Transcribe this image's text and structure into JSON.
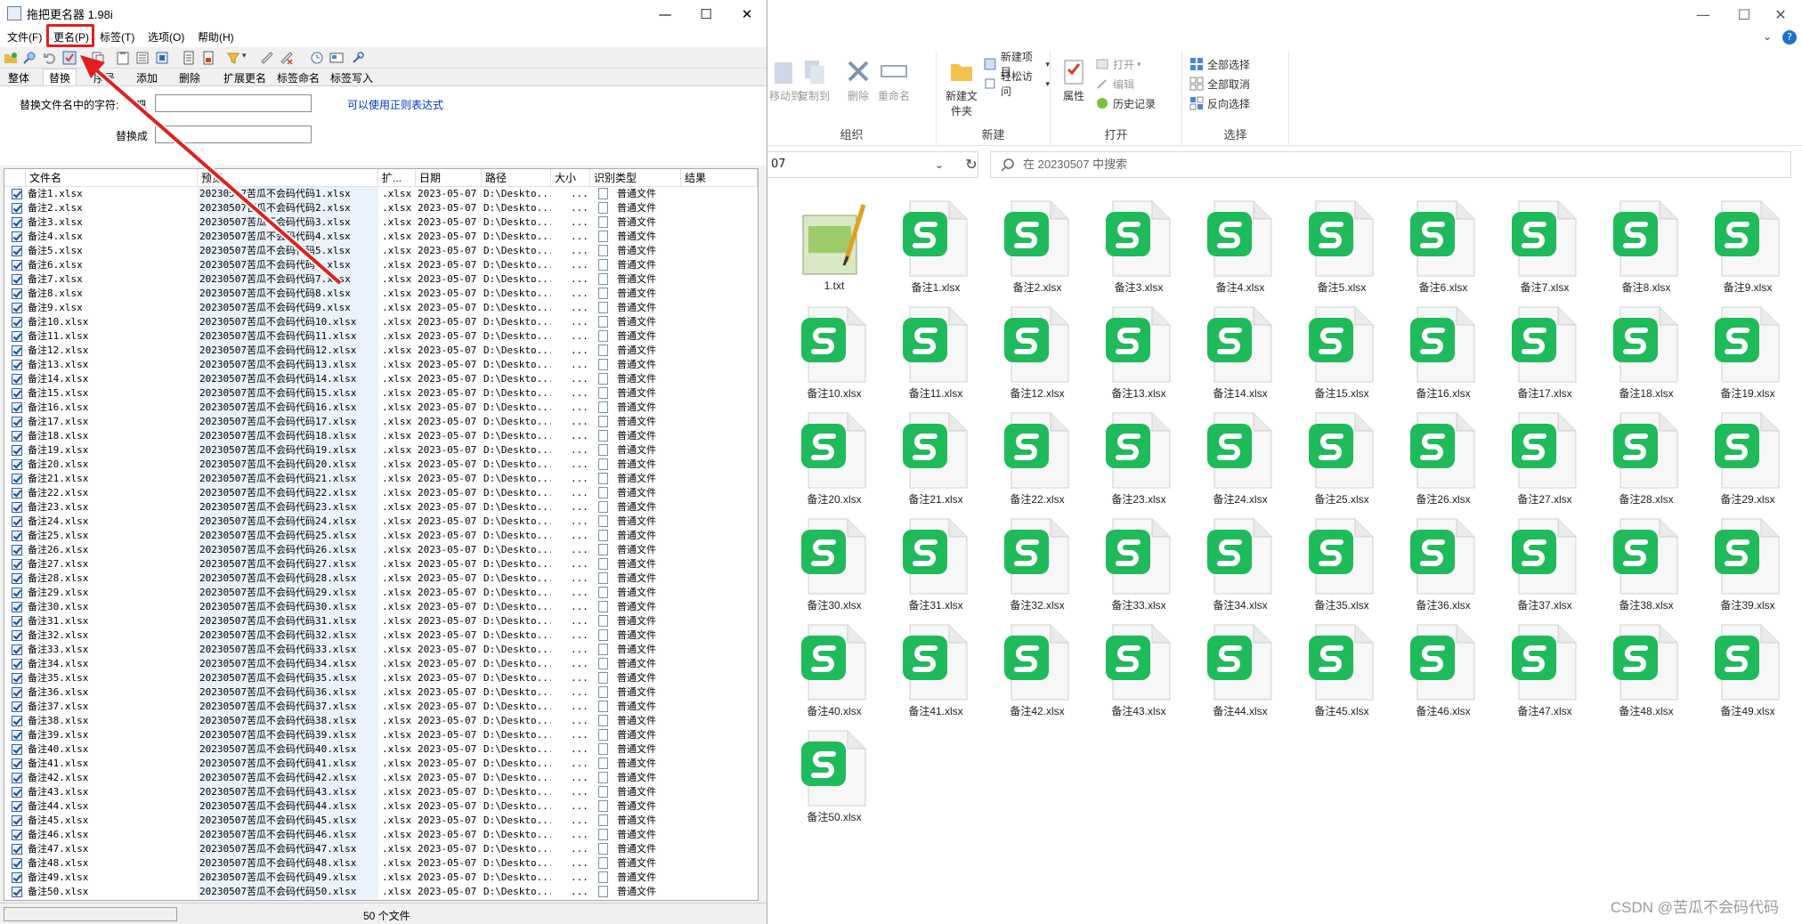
{
  "renamer": {
    "title": "拖把更名器 1.98i",
    "menu": [
      {
        "label": "文件(F)"
      },
      {
        "label": "更名(P)"
      },
      {
        "label": "标签(T)"
      },
      {
        "label": "选项(O)"
      },
      {
        "label": "帮助(H)"
      }
    ],
    "tabs": [
      "整体",
      "替换",
      "序号",
      "添加",
      "删除",
      "扩展更名",
      "标签命名",
      "标签写入"
    ],
    "active_tab": "替换",
    "panel": {
      "replace_label": "替换文件名中的字符:",
      "replace_value": "",
      "replace_with_label": "替换成",
      "replace_with_value": "",
      "regex_hint": "可以使用正则表达式",
      "partial_label": "吧"
    },
    "columns": [
      "文件名",
      "预览",
      "扩...",
      "日期",
      "路径",
      "大小",
      "识别类型",
      "结果"
    ],
    "row_common": {
      "ext": ".xlsx",
      "date": "2023-05-07",
      "path": "D:\\Deskto...",
      "size": "...",
      "type": "普通文件",
      "result": ""
    },
    "preview_prefix": "20230507苦瓜不会码代码",
    "file_prefix": "备注",
    "file_suffix": ".xlsx",
    "row_count": 50,
    "status": "50 个文件"
  },
  "explorer": {
    "ribbon": {
      "groups": [
        {
          "name": "组织",
          "items": [
            "移动到",
            "复制到",
            "删除",
            "重命名"
          ]
        },
        {
          "name": "新建",
          "items": [
            "新建文件夹",
            "新建项目",
            "轻松访问"
          ]
        },
        {
          "name": "打开",
          "items": [
            "属性",
            "打开",
            "编辑",
            "历史记录"
          ]
        },
        {
          "name": "选择",
          "items": [
            "全部选择",
            "全部取消",
            "反向选择"
          ]
        }
      ]
    },
    "address": "07",
    "search_placeholder": "在 20230507 中搜索",
    "files": [
      "1.txt",
      "备注1.xlsx",
      "备注2.xlsx",
      "备注3.xlsx",
      "备注4.xlsx",
      "备注5.xlsx",
      "备注6.xlsx",
      "备注7.xlsx",
      "备注8.xlsx",
      "备注9.xlsx",
      "备注10.xlsx",
      "备注11.xlsx",
      "备注12.xlsx",
      "备注13.xlsx",
      "备注14.xlsx",
      "备注15.xlsx",
      "备注16.xlsx",
      "备注17.xlsx",
      "备注18.xlsx",
      "备注19.xlsx",
      "备注20.xlsx",
      "备注21.xlsx",
      "备注22.xlsx",
      "备注23.xlsx",
      "备注24.xlsx",
      "备注25.xlsx",
      "备注26.xlsx",
      "备注27.xlsx",
      "备注28.xlsx",
      "备注29.xlsx",
      "备注30.xlsx",
      "备注31.xlsx",
      "备注32.xlsx",
      "备注33.xlsx",
      "备注34.xlsx",
      "备注35.xlsx",
      "备注36.xlsx",
      "备注37.xlsx",
      "备注38.xlsx",
      "备注39.xlsx",
      "备注40.xlsx",
      "备注41.xlsx",
      "备注42.xlsx",
      "备注43.xlsx",
      "备注44.xlsx",
      "备注45.xlsx",
      "备注46.xlsx",
      "备注47.xlsx",
      "备注48.xlsx",
      "备注49.xlsx",
      "备注50.xlsx"
    ]
  },
  "watermark": "CSDN @苦瓜不会码代码",
  "colors": {
    "accent_red": "#e02020",
    "wps_green": "#1fba5a",
    "link_blue": "#0033cc"
  }
}
